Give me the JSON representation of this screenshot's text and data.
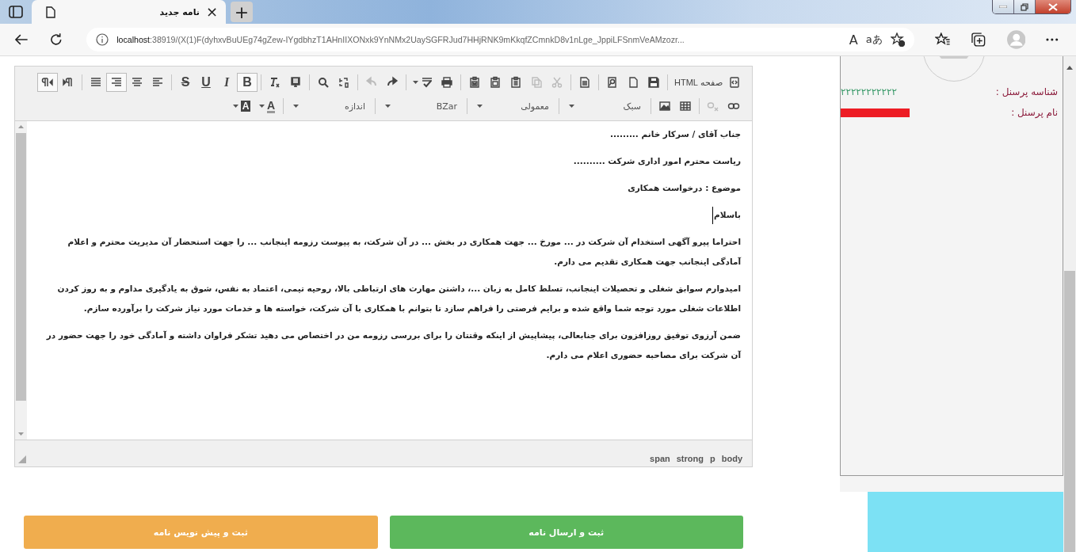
{
  "browser": {
    "tab": {
      "title": "نامه جدید",
      "close": "×"
    },
    "new_tab": "+",
    "address": {
      "host": "localhost",
      "path": ":38919/(X(1)F(dyhxvBuUEg74gZew-IYgdbhzT1AHnIIXONxk9YnNMx2UaySGFRJud7HHjRNK9mKkqfZCmnkD8v1nLge_JppiLFSnmVeAMzozr..."
    },
    "read_aloud": "A",
    "translate": "aあ"
  },
  "editor": {
    "toolbar": {
      "row_1": [
        {
          "kind": "labeled",
          "label": "صفحه HTML",
          "selected": false,
          "disabled": false
        },
        {
          "kind": "separator"
        },
        {
          "kind": "icon",
          "selected": false,
          "disabled": false
        },
        {
          "kind": "icon",
          "selected": false,
          "disabled": false
        },
        {
          "kind": "icon",
          "selected": false,
          "disabled": false
        },
        {
          "kind": "separator"
        },
        {
          "kind": "icon",
          "selected": false,
          "disabled": false
        },
        {
          "kind": "separator"
        },
        {
          "kind": "icon",
          "selected": false,
          "disabled": true
        },
        {
          "kind": "icon",
          "selected": false,
          "disabled": true
        },
        {
          "kind": "icon",
          "selected": false,
          "disabled": false
        },
        {
          "kind": "icon",
          "selected": false,
          "disabled": false
        },
        {
          "kind": "icon",
          "selected": false,
          "disabled": false
        },
        {
          "kind": "separator"
        },
        {
          "kind": "icon",
          "selected": false,
          "disabled": false
        },
        {
          "kind": "iconmenu",
          "selected": false,
          "disabled": false
        },
        {
          "kind": "separator"
        },
        {
          "kind": "icon",
          "selected": false,
          "disabled": false
        },
        {
          "kind": "icon",
          "selected": false,
          "disabled": true
        },
        {
          "kind": "separator"
        },
        {
          "kind": "icon",
          "selected": false,
          "disabled": false
        },
        {
          "kind": "icon",
          "selected": false,
          "disabled": false
        },
        {
          "kind": "separator"
        },
        {
          "kind": "icon",
          "selected": false,
          "disabled": false
        },
        {
          "kind": "icon",
          "selected": false,
          "disabled": false
        },
        {
          "kind": "separator"
        },
        {
          "kind": "glyph",
          "glyph": "B",
          "selected": true,
          "disabled": false
        },
        {
          "kind": "glyph",
          "glyph": "I",
          "selected": false,
          "disabled": false
        },
        {
          "kind": "glyph",
          "glyph": "U",
          "selected": false,
          "disabled": false
        },
        {
          "kind": "glyph",
          "glyph": "S",
          "selected": false,
          "disabled": false
        },
        {
          "kind": "separator"
        },
        {
          "kind": "icon",
          "selected": false,
          "disabled": false
        },
        {
          "kind": "icon",
          "selected": false,
          "disabled": false
        },
        {
          "kind": "icon",
          "selected": true,
          "disabled": false
        },
        {
          "kind": "icon",
          "selected": false,
          "disabled": false
        },
        {
          "kind": "separator"
        },
        {
          "kind": "icon",
          "selected": false,
          "disabled": false
        },
        {
          "kind": "icon",
          "selected": true,
          "disabled": false
        }
      ],
      "row_2": [
        {
          "kind": "icon",
          "selected": false,
          "disabled": false
        },
        {
          "kind": "icon",
          "selected": false,
          "disabled": true
        },
        {
          "kind": "separator"
        },
        {
          "kind": "icon",
          "selected": false,
          "disabled": false
        },
        {
          "kind": "icon",
          "selected": false,
          "disabled": false
        },
        {
          "kind": "separator"
        },
        {
          "kind": "dropdown",
          "label": "سبک"
        },
        {
          "kind": "separator"
        },
        {
          "kind": "dropdown",
          "label": "معمولی"
        },
        {
          "kind": "separator"
        },
        {
          "kind": "dropdown",
          "label": "BZar"
        },
        {
          "kind": "separator"
        },
        {
          "kind": "dropdown",
          "label": "اندازه"
        },
        {
          "kind": "separator"
        },
        {
          "kind": "fgcolor",
          "glyph": "A",
          "selected": false,
          "disabled": false
        },
        {
          "kind": "bgcolor",
          "glyph": "A",
          "selected": false,
          "disabled": false
        }
      ]
    },
    "paragraphs": [
      {
        "text": "جناب آقای / سرکار خانم .........",
        "cursor": false
      },
      {
        "text": "ریاست محترم امور اداری شرکت ..........",
        "cursor": false
      },
      {
        "text": "موضوع : درخواست همکاری",
        "cursor": false
      },
      {
        "text": "باسلام",
        "cursor": true
      },
      {
        "text": "احتراما پیرو آگهی استخدام آن شرکت در ... مورخ ... جهت همکاری در بخش ... در آن شرکت، به پیوست رزومه اینجانب ... را جهت استحضار آن مدیریت محترم و اعلام آمادگی اینجانب جهت همکاری تقدیم می دارم.",
        "cursor": false
      },
      {
        "text": "امیدوارم سوابق شغلی و تحصیلات اینجانب، تسلط کامل به زبان ...، داشتن مهارت های ارتباطی بالا، روحیه تیمی، اعتماد به نفس، شوق به یادگیری مداوم و به روز کردن اطلاعات شغلی مورد توجه شما واقع شده و برایم فرصتی را فراهم سازد تا بتوانم با همکاری با آن شرکت، خواسته ها و خدمات مورد نیاز شرکت را برآورده سازم.",
        "cursor": false
      },
      {
        "text": "ضمن آرزوی توفیق روزافزون برای جنابعالی، پیشاپیش از اینکه وقتتان را برای بررسی رزومه من در اختصاص می دهید تشکر فراوان داشته و آمادگی خود را جهت حضور در آن شرکت برای مصاحبه حضوری اعلام می دارم.",
        "cursor": false
      }
    ],
    "element_path": [
      "body",
      "p",
      "strong",
      "span"
    ]
  },
  "buttons": [
    {
      "label": "ثبت و ارسال نامه",
      "color": "#5cb85c"
    },
    {
      "label": "ثبت و پیش نویس نامه",
      "color": "#f0ad4e"
    }
  ],
  "profile": {
    "fields": [
      {
        "label": "شناسه پرسنل :",
        "value": "۲۲۲۲۲۲۲۲۲۲۲"
      },
      {
        "label": "نام پرسنل :"
      }
    ]
  }
}
